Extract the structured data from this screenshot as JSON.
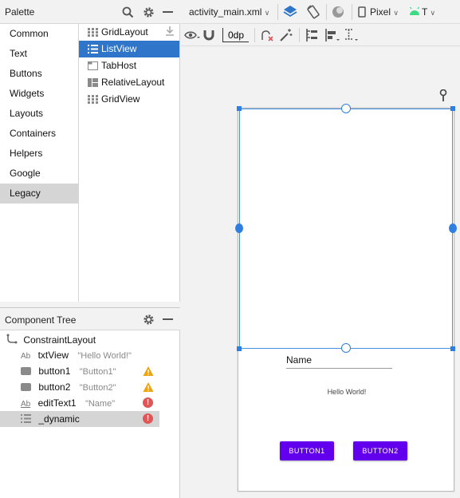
{
  "palette": {
    "title": "Palette",
    "categories": [
      "Common",
      "Text",
      "Buttons",
      "Widgets",
      "Layouts",
      "Containers",
      "Helpers",
      "Google",
      "Legacy"
    ],
    "selected_category": "Legacy",
    "components": [
      "GridLayout",
      "ListView",
      "TabHost",
      "RelativeLayout",
      "GridView"
    ],
    "selected_component": "ListView"
  },
  "toolbar": {
    "file": "activity_main.xml",
    "device": "Pixel",
    "api": "T",
    "margin": "0dp"
  },
  "tree": {
    "title": "Component Tree",
    "root": "ConstraintLayout",
    "items": [
      {
        "name": "txtView",
        "detail": "\"Hello World!\"",
        "icon": "Ab",
        "status": ""
      },
      {
        "name": "button1",
        "detail": "\"Button1\"",
        "icon": "button",
        "status": "warning"
      },
      {
        "name": "button2",
        "detail": "\"Button2\"",
        "icon": "button",
        "status": "warning"
      },
      {
        "name": "editText1",
        "detail": "\"Name\"",
        "icon": "Ab",
        "status": "error"
      },
      {
        "name": "_dynamic",
        "detail": "",
        "icon": "list",
        "status": "error"
      }
    ]
  },
  "design": {
    "edit_text": "Name",
    "hello_text": "Hello World!",
    "button1": "BUTTON1",
    "button2": "BUTTON2"
  },
  "colors": {
    "accent": "#2f75c9",
    "app_button": "#6200ee",
    "warning": "#f0a30a",
    "error": "#e05555"
  }
}
